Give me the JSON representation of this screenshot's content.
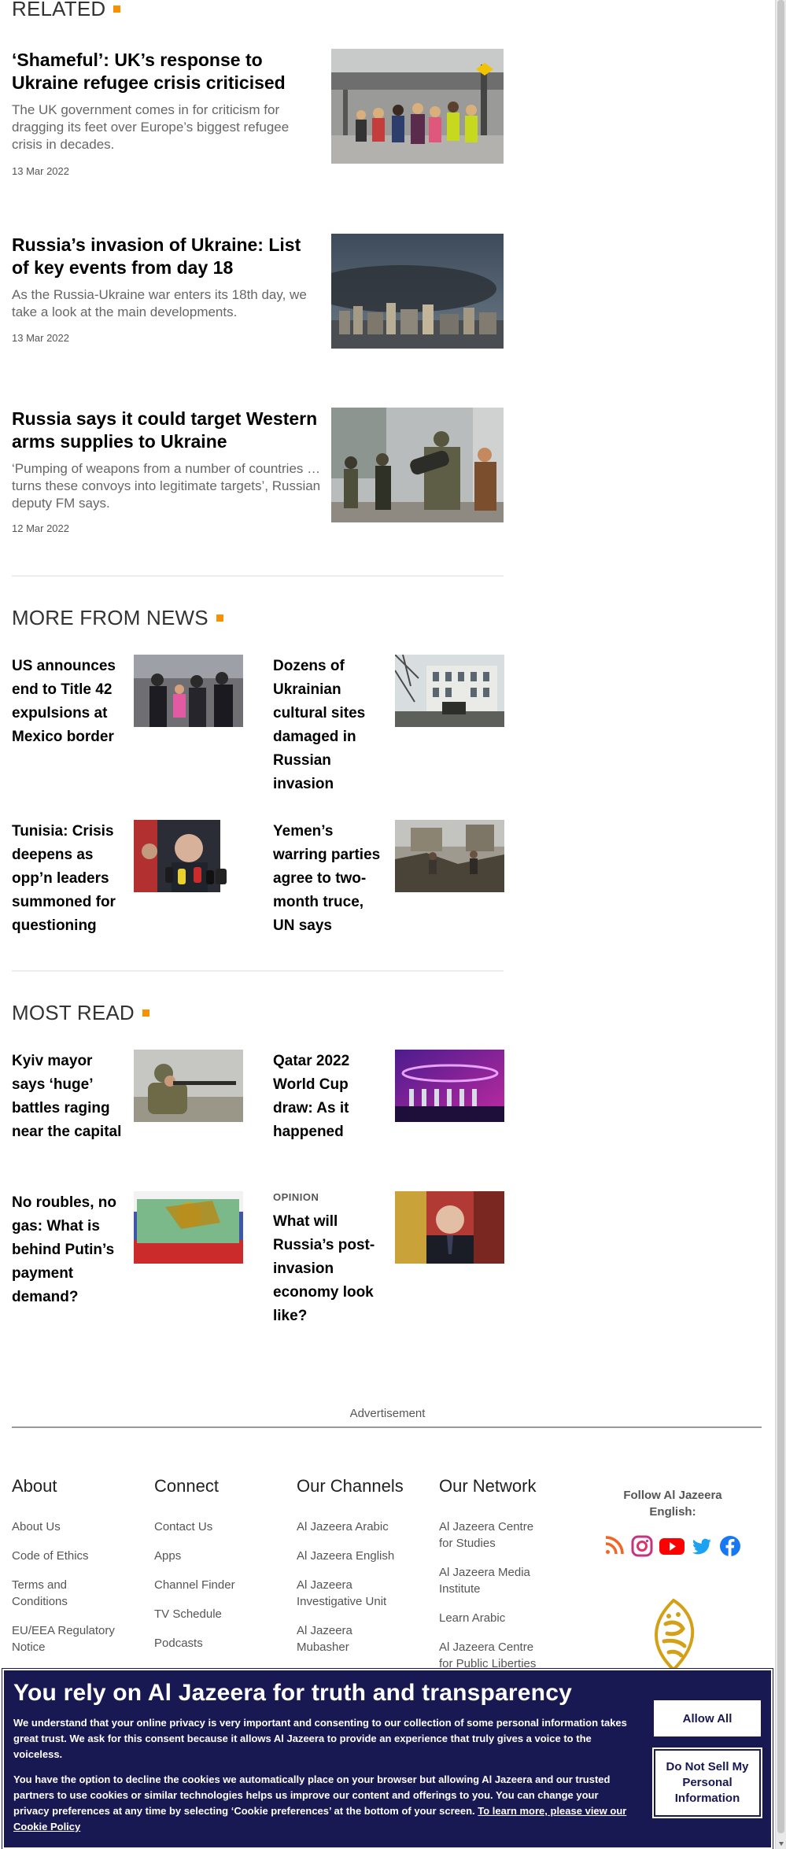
{
  "related": {
    "heading": "RELATED",
    "items": [
      {
        "title": "‘Shameful’: UK’s response to Ukraine refugee crisis criticised",
        "summary": "The UK government comes in for criticism for dragging its feet over Europe’s biggest refugee crisis in decades.",
        "date": "13 Mar 2022",
        "image_icon": "refugees-crossing-photo"
      },
      {
        "title": "Russia’s invasion of Ukraine: List of key events from day 18",
        "summary": "As the Russia-Ukraine war enters its 18th day, we take a look at the main developments.",
        "date": "13 Mar 2022",
        "image_icon": "city-smoke-photo"
      },
      {
        "title": "Russia says it could target Western arms supplies to Ukraine",
        "summary": "‘Pumping of weapons from a number of coun­tries … turns these convoys into legitimate tar­gets’, Russian deputy FM says.",
        "date": "12 Mar 2022",
        "image_icon": "soldiers-weapons-photo"
      }
    ]
  },
  "more_from_news": {
    "heading": "MORE FROM NEWS",
    "items": [
      {
        "title": "US announces end to Title 42 expulsions at Mexico border",
        "image_icon": "border-agents-photo"
      },
      {
        "title": "Dozens of Ukrainian cultural sites damaged in Russian invasion",
        "image_icon": "damaged-building-photo"
      },
      {
        "title": "Tunisia: Crisis deepens as opp’n leaders summoned for questioning",
        "image_icon": "press-microphones-photo"
      },
      {
        "title": "Yemen’s warring parties agree to two-month truce, UN says",
        "image_icon": "rubble-photo"
      }
    ]
  },
  "most_read": {
    "heading": "MOST READ",
    "items": [
      {
        "title": "Kyiv mayor says ‘huge’ battles raging near the capital",
        "kicker": "",
        "image_icon": "soldier-rifle-photo"
      },
      {
        "title": "Qatar 2022 World Cup draw: As it happened",
        "kicker": "",
        "image_icon": "world-cup-draw-photo"
      },
      {
        "title": "No roubles, no gas: What is behind Putin’s payment demand?",
        "kicker": "",
        "image_icon": "rouble-banknote-photo"
      },
      {
        "title": "What will Russia’s post-invasion economy look like?",
        "kicker": "OPINION",
        "image_icon": "putin-portrait-photo"
      }
    ]
  },
  "advertisement_label": "Advertisement",
  "footer": {
    "columns": [
      {
        "heading": "About",
        "links": [
          "About Us",
          "Code of Ethics",
          "Terms and Conditions",
          "EU/EEA Regulatory Notice"
        ]
      },
      {
        "heading": "Connect",
        "links": [
          "Contact Us",
          "Apps",
          "Channel Finder",
          "TV Schedule",
          "Podcasts"
        ]
      },
      {
        "heading": "Our Channels",
        "links": [
          "Al Jazeera Arabic",
          "Al Jazeera English",
          "Al Jazeera Investigative Unit",
          "Al Jazeera Mubasher"
        ]
      },
      {
        "heading": "Our Network",
        "links": [
          "Al Jazeera Centre for Studies",
          "Al Jazeera Media Institute",
          "Learn Arabic",
          "Al Jazeera Centre for Public Liberties"
        ]
      }
    ],
    "follow_label": "Follow Al Jazeera English:",
    "social_icons": [
      "rss-icon",
      "instagram-icon",
      "youtube-icon",
      "twitter-icon",
      "facebook-icon"
    ],
    "colors": {
      "rss": "#f26522",
      "instagram": "#c13584",
      "youtube": "#ff0000",
      "twitter": "#1da1f2",
      "facebook": "#1877f2",
      "logo": "#d4a017"
    }
  },
  "consent": {
    "heading": "You rely on Al Jazeera for truth and transparency",
    "paragraph1": "We understand that your online privacy is very important and consenting to our collection of some personal information takes great trust. We ask for this consent because it allows Al Jazeera to provide an experience that truly gives a voice to the voiceless.",
    "paragraph2": "You have the option to decline the cookies we automatically place on your browser but allowing Al Jazeera and our trusted partners to use cookies or similar technologies helps us improve our content and offerings to you. You can change your privacy preferences at any time by selecting ‘Cookie preferences’ at the bottom of your screen.",
    "link_text": "To learn more, please view our Cookie Policy",
    "allow_all_label": "Allow All",
    "do_not_sell_label": "Do Not Sell My Personal Information",
    "background_color": "#181852"
  },
  "accent_color": "#fa9000"
}
